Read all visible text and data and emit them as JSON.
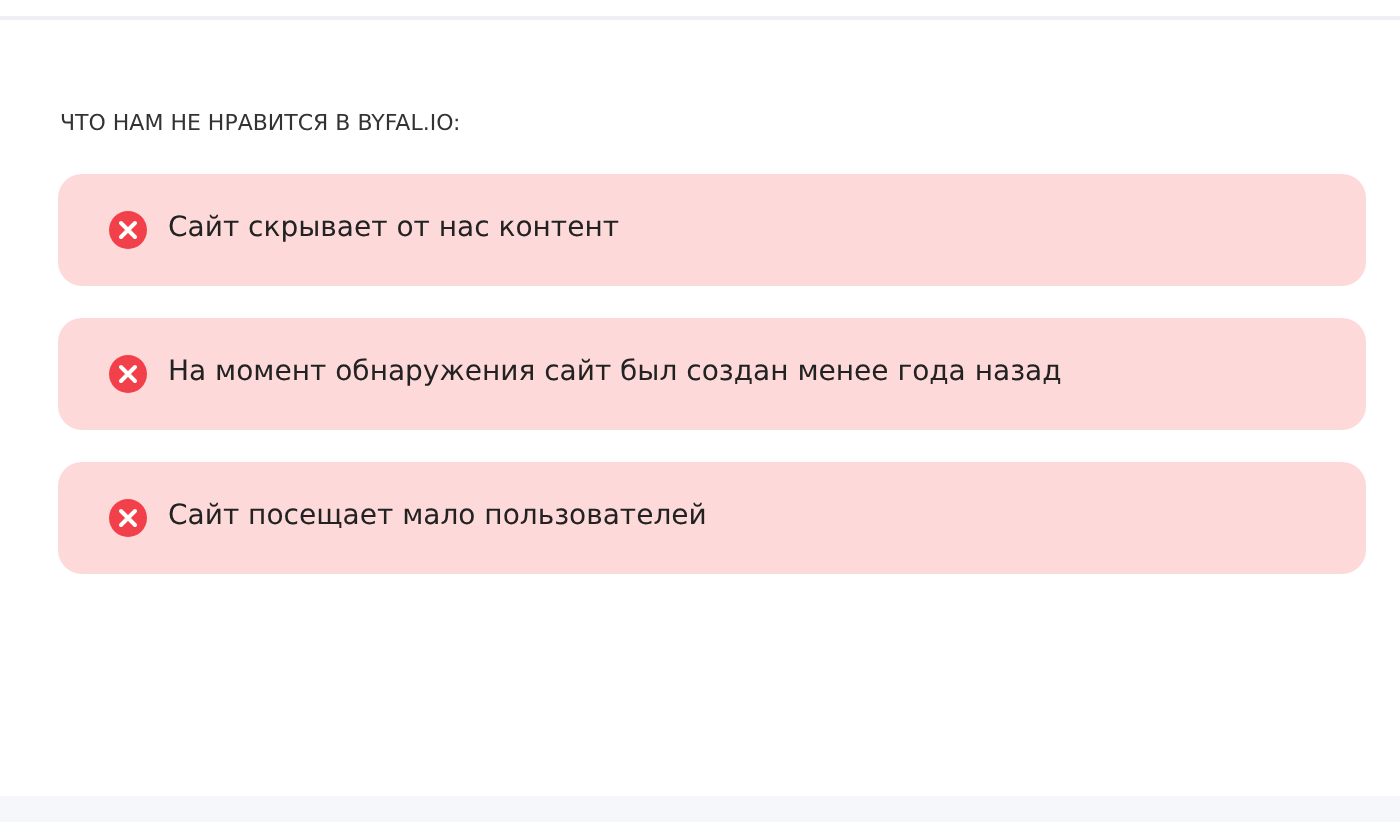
{
  "heading": "ЧТО НАМ НЕ НРАВИТСЯ В BYFAL.IO:",
  "items": [
    {
      "kind": "negative",
      "text": "Сайт скрывает от нас контент"
    },
    {
      "kind": "negative",
      "text": "На момент обнаружения сайт был создан менее года назад"
    },
    {
      "kind": "negative",
      "text": "Сайт посещает мало пользователей"
    }
  ]
}
